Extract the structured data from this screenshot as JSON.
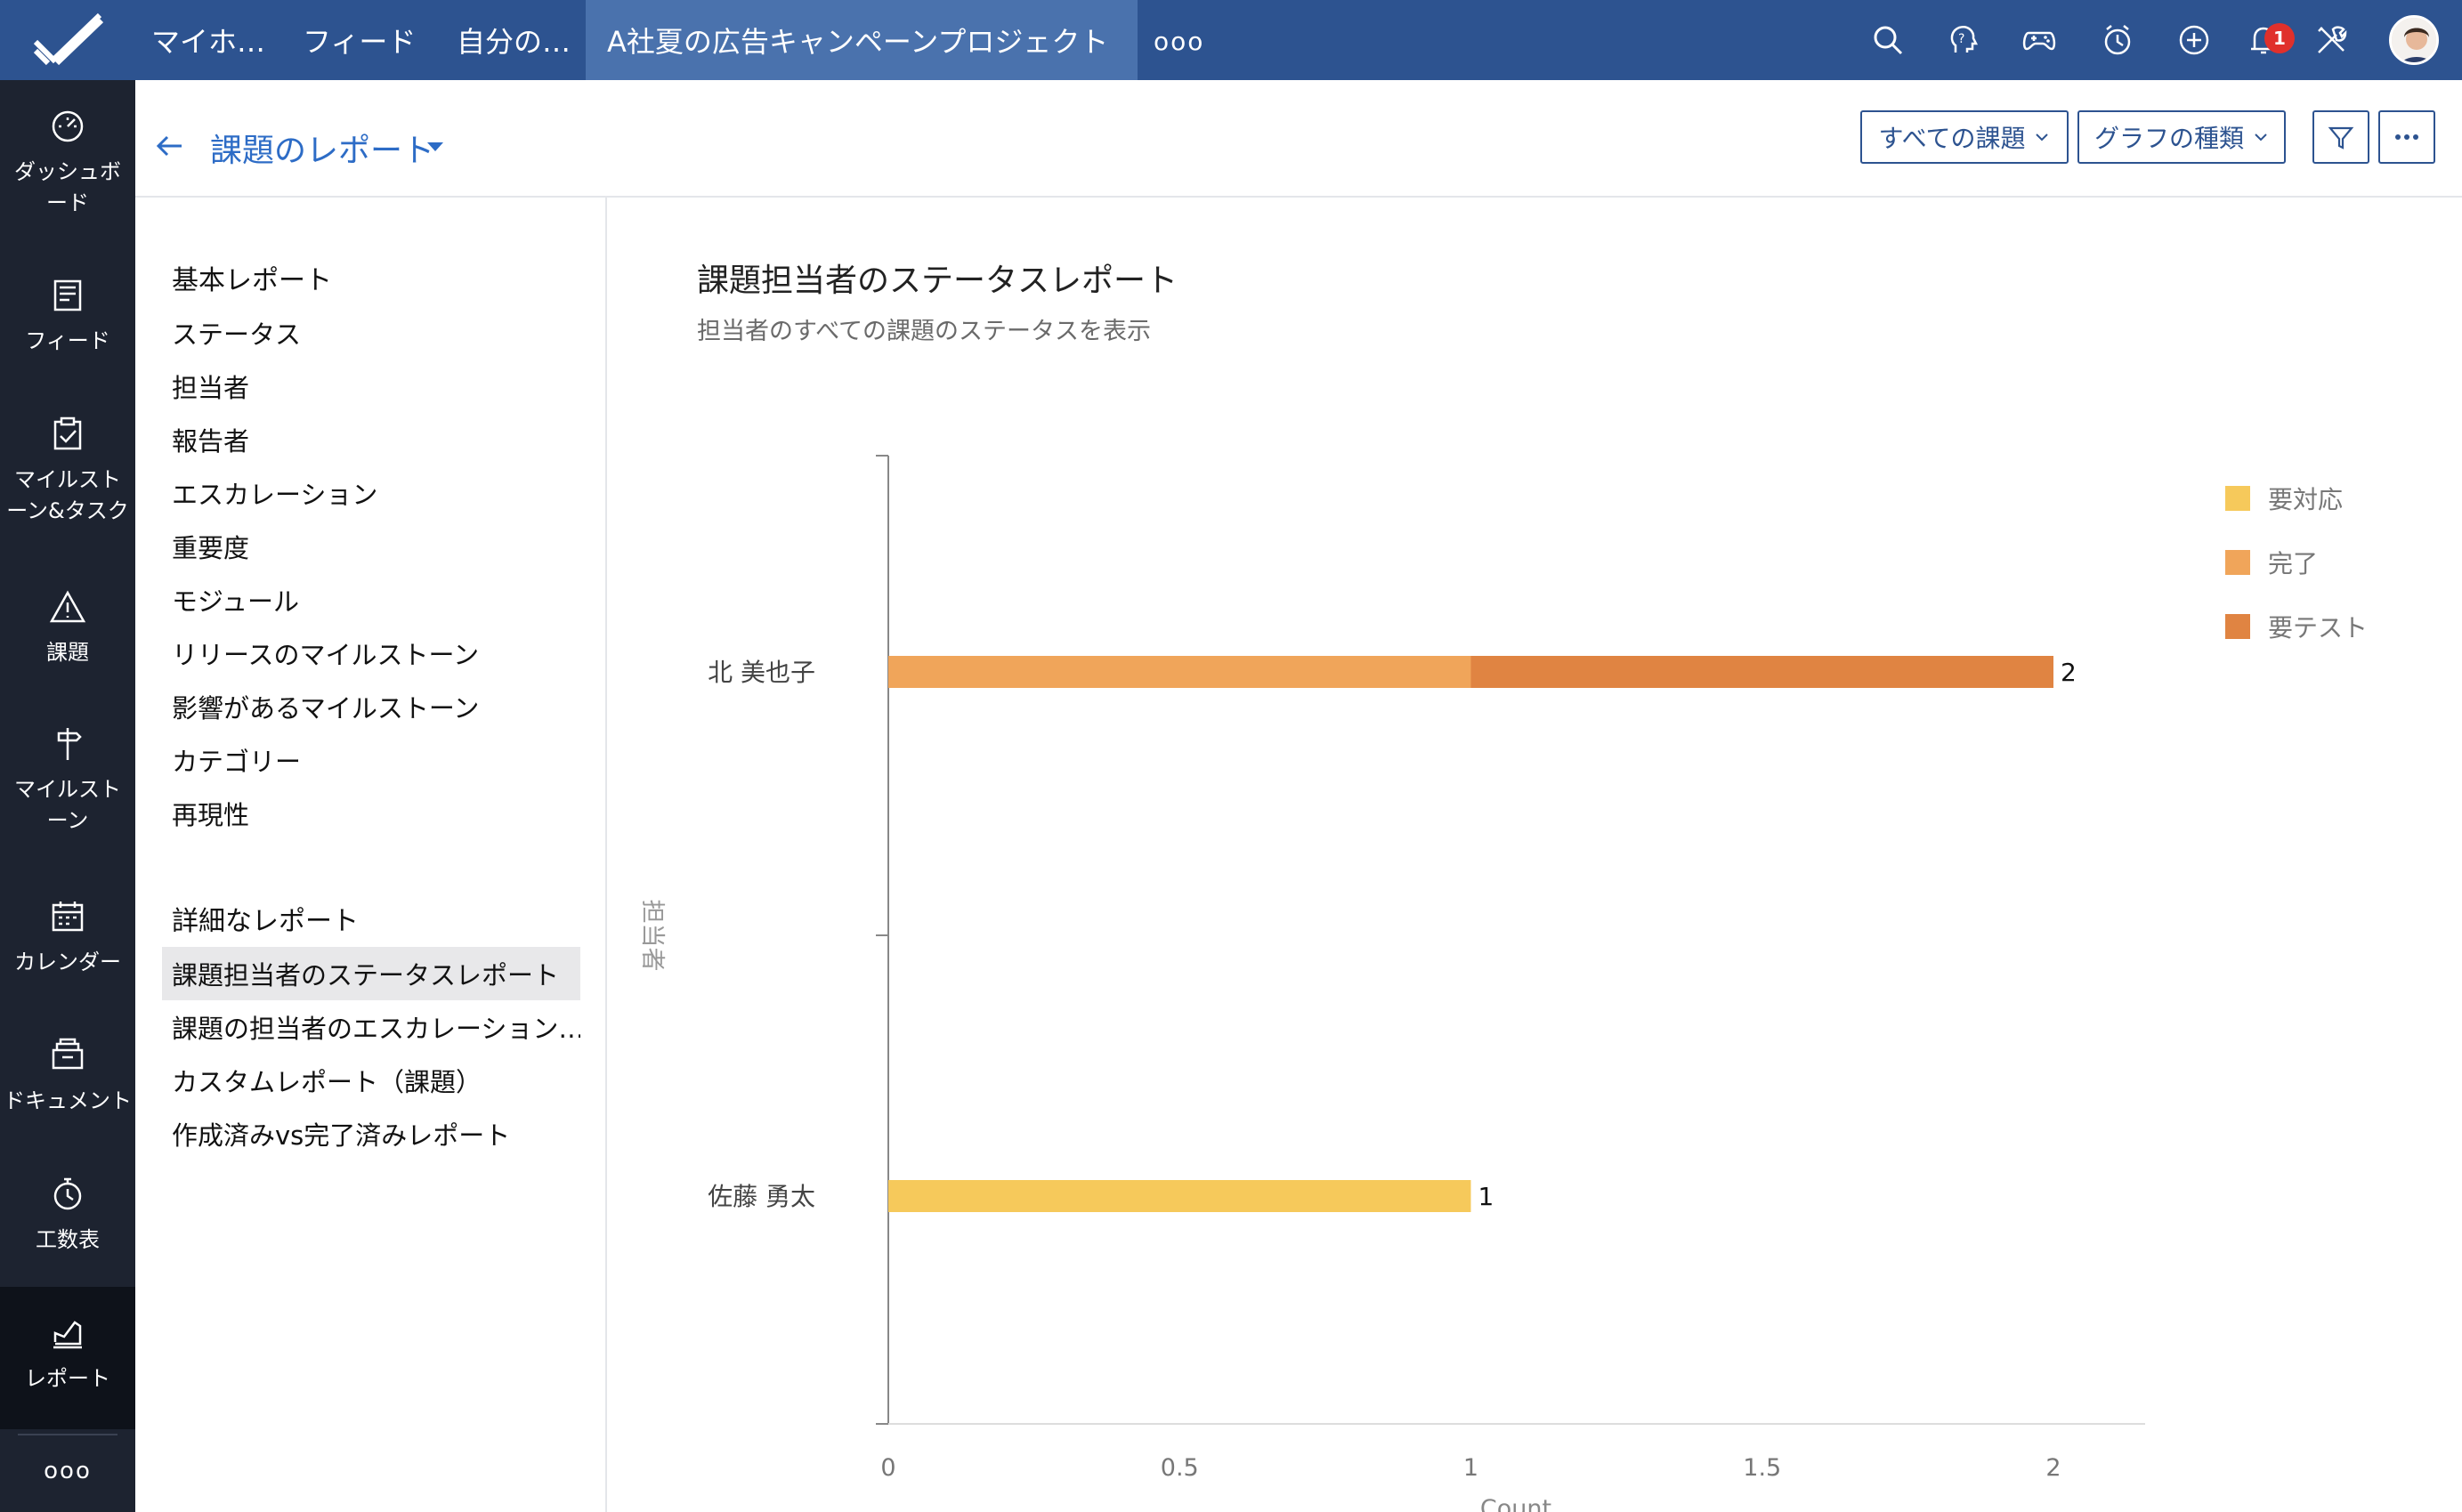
{
  "topbar": {
    "nav": [
      {
        "label": "マイホ…"
      },
      {
        "label": "フィード"
      },
      {
        "label": "自分の…"
      },
      {
        "label": "A社夏の広告キャンペーンプロジェクト"
      }
    ],
    "more": "ooo",
    "notification_count": "1",
    "icons": [
      "search-icon",
      "help-icon",
      "game-icon",
      "timer-icon",
      "add-icon",
      "bell-icon",
      "tools-icon",
      "avatar"
    ]
  },
  "sidebar": {
    "items": [
      {
        "label": "ダッシュボード",
        "icon": "dashboard-icon"
      },
      {
        "label": "フィード",
        "icon": "feed-icon"
      },
      {
        "label": "マイルストーン&タスク",
        "icon": "milestone-task-icon"
      },
      {
        "label": "課題",
        "icon": "issue-icon"
      },
      {
        "label": "マイルストーン",
        "icon": "signpost-icon"
      },
      {
        "label": "カレンダー",
        "icon": "calendar-icon"
      },
      {
        "label": "ドキュメント",
        "icon": "documents-icon"
      },
      {
        "label": "工数表",
        "icon": "timesheet-icon"
      },
      {
        "label": "レポート",
        "icon": "reports-icon"
      }
    ],
    "more": "ooo"
  },
  "header": {
    "title": "課題のレポート",
    "filter_all_issues": "すべての課題",
    "graph_type": "グラフの種類"
  },
  "left_panel": {
    "basic_title": "基本レポート",
    "basic_items": [
      "ステータス",
      "担当者",
      "報告者",
      "エスカレーション",
      "重要度",
      "モジュール",
      "リリースのマイルストーン",
      "影響があるマイルストーン",
      "カテゴリー",
      "再現性"
    ],
    "detail_title": "詳細なレポート",
    "detail_items": [
      "課題担当者のステータスレポート",
      "課題の担当者のエスカレーション…",
      "カスタムレポート（課題）",
      "作成済みvs完了済みレポート"
    ]
  },
  "chart_data": {
    "type": "bar",
    "orientation": "horizontal",
    "stacked": true,
    "title": "課題担当者のステータスレポート",
    "subtitle": "担当者のすべての課題のステータスを表示",
    "xlabel": "Count",
    "ylabel": "担当者",
    "categories": [
      "北 美也子",
      "佐藤 勇太"
    ],
    "series": [
      {
        "name": "要対応",
        "color": "#f6c95b",
        "values": [
          0,
          1
        ]
      },
      {
        "name": "完了",
        "color": "#f0a55a",
        "values": [
          1,
          0
        ]
      },
      {
        "name": "要テスト",
        "color": "#e08442",
        "values": [
          1,
          0
        ]
      }
    ],
    "totals": [
      "2",
      "1"
    ],
    "xlim": [
      0,
      2.15
    ],
    "xticks": [
      "0",
      "0.5",
      "1",
      "1.5",
      "2"
    ],
    "legend_position": "right"
  }
}
